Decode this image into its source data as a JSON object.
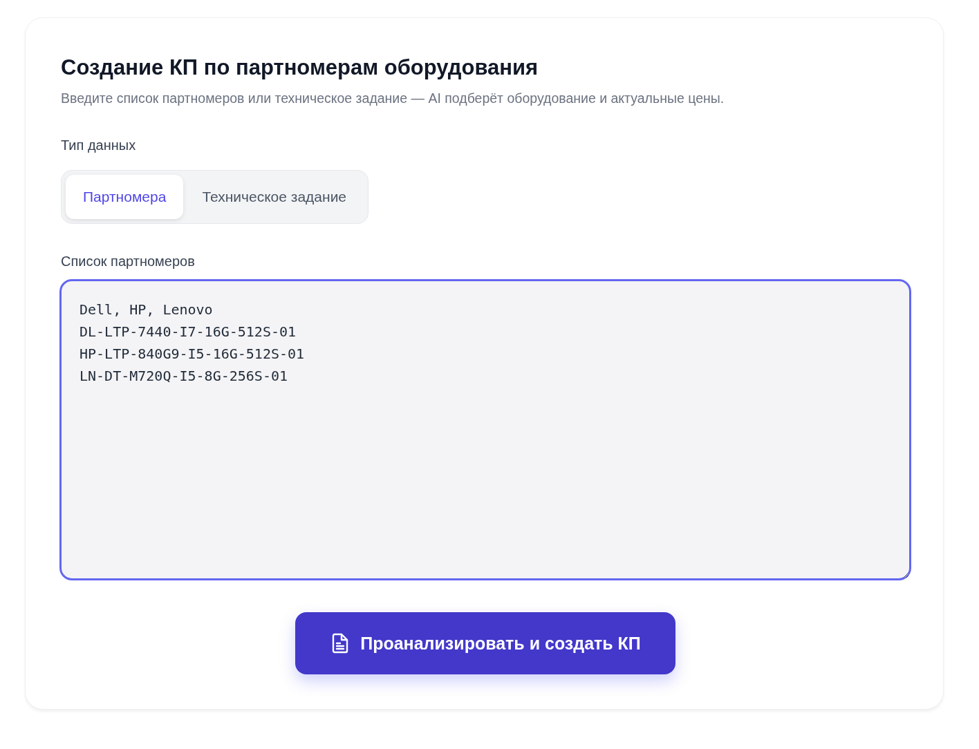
{
  "title": "Создание КП по партномерам оборудования",
  "subtitle": "Введите список партномеров или техническое задание — AI подберёт оборудование и актуальные цены.",
  "data_type": {
    "label": "Тип данных",
    "tabs": [
      {
        "label": "Партномера",
        "selected": true
      },
      {
        "label": "Техническое задание",
        "selected": false
      }
    ]
  },
  "input": {
    "label": "Список партномеров",
    "focused": true,
    "value": "Dell, HP, Lenovo\nDL-LTP-7440-I7-16G-512S-01\nHP-LTP-840G9-I5-16G-512S-01\nLN-DT-M720Q-I5-8G-256S-01"
  },
  "submit_button": {
    "label": "Проанализировать и создать КП"
  }
}
